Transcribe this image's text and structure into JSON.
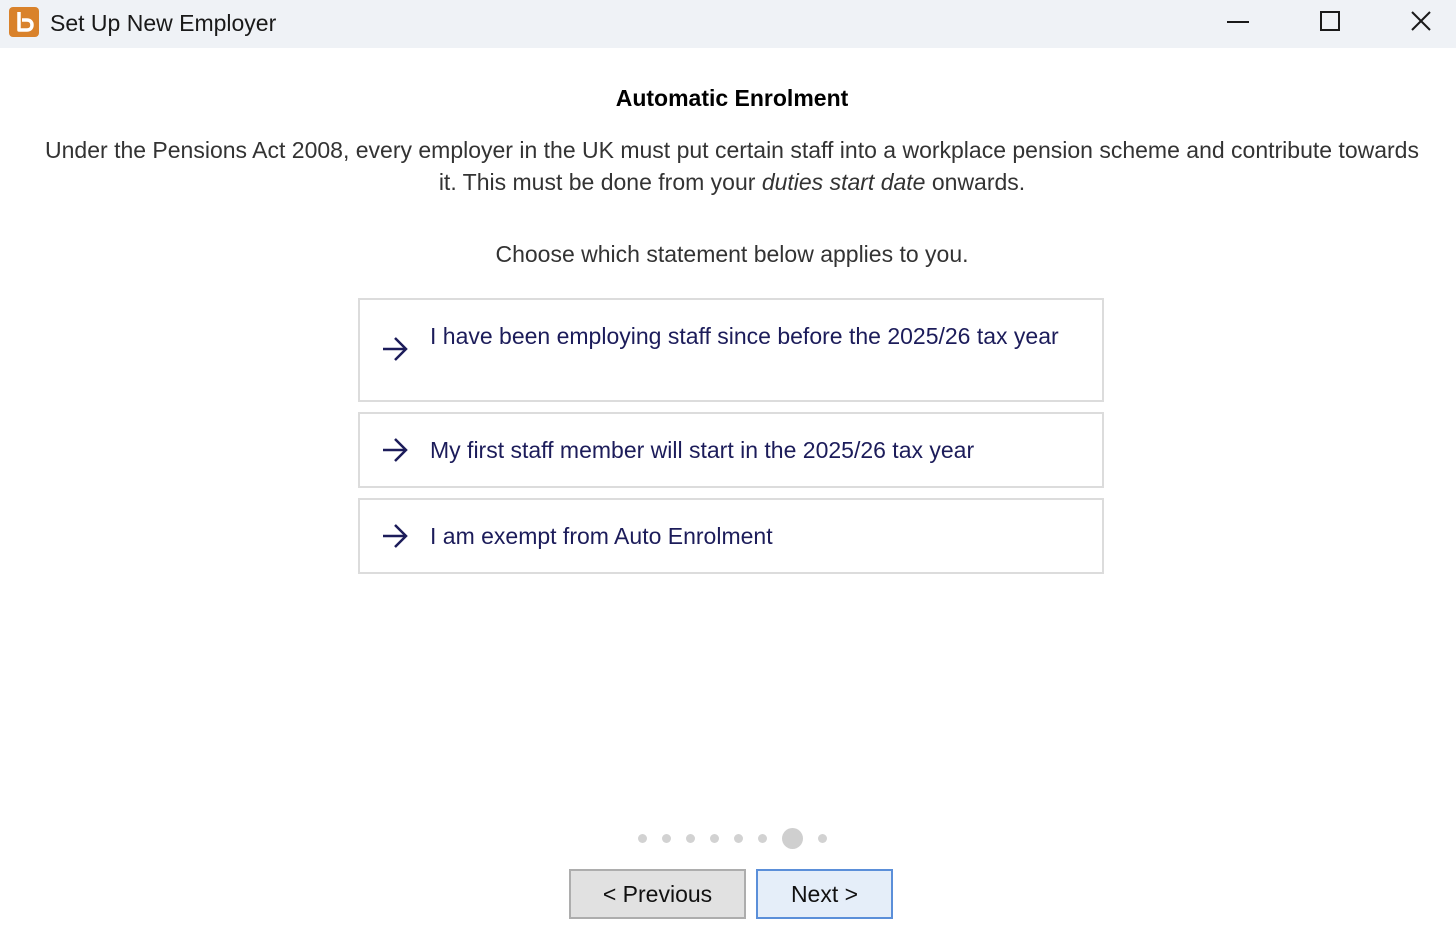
{
  "window": {
    "title": "Set Up New Employer",
    "app_icon": "app-logo-icon",
    "controls": [
      "minimize-icon",
      "maximize-icon",
      "close-icon"
    ]
  },
  "main": {
    "heading": "Automatic Enrolment",
    "intro_part1": "Under the Pensions Act 2008, every employer in the UK must put certain staff into a workplace pension scheme and contribute towards it. This must be done from your ",
    "intro_emphasis": "duties start date",
    "intro_part2": " onwards.",
    "prompt": "Choose which statement below applies to you.",
    "options": [
      {
        "label": "I have been employing staff since before the 2025/26 tax year",
        "icon": "arrow-right-icon"
      },
      {
        "label": "My first staff member will start in the 2025/26 tax year",
        "icon": "arrow-right-icon"
      },
      {
        "label": "I am exempt from Auto Enrolment",
        "icon": "arrow-right-icon"
      }
    ]
  },
  "wizard": {
    "total_steps": 8,
    "current_step": 7
  },
  "buttons": {
    "previous": "< Previous",
    "next": "Next >"
  },
  "colors": {
    "accent": "#d9822b",
    "option_text": "#1c1c5a",
    "next_border": "#5b8fd9"
  }
}
